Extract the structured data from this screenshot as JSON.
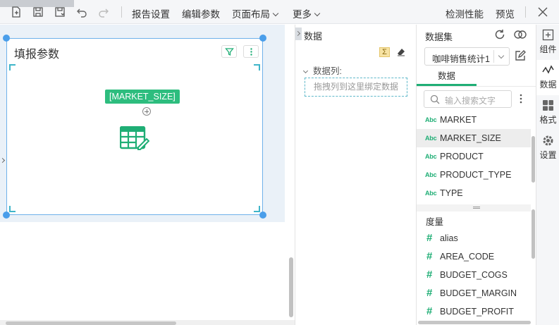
{
  "toolbar": {
    "report_settings": "报告设置",
    "edit_params": "编辑参数",
    "page_layout": "页面布局",
    "more": "更多",
    "check_performance": "检测性能",
    "preview": "预览"
  },
  "widget": {
    "title": "填报参数",
    "tag": "[MARKET_SIZE]"
  },
  "data_panel": {
    "title": "数据",
    "sum_symbol": "Σ",
    "columns_label": "数据列:",
    "drop_placeholder": "拖拽列到这里绑定数据"
  },
  "dataset_panel": {
    "label": "数据集",
    "selected_dataset": "咖啡销售统计1",
    "tab_data": "数据",
    "search_placeholder": "输入搜索文字",
    "dimension_badge": "Abc",
    "measure_badge": "#",
    "dimensions": [
      "MARKET",
      "MARKET_SIZE",
      "PRODUCT",
      "PRODUCT_TYPE",
      "TYPE"
    ],
    "selected_dimension": "MARKET_SIZE",
    "measures_label": "度量",
    "measures": [
      "alias",
      "AREA_CODE",
      "BUDGET_COGS",
      "BUDGET_MARGIN",
      "BUDGET_PROFIT"
    ]
  },
  "rail": {
    "items": [
      "组件",
      "数据",
      "格式",
      "设置"
    ],
    "active": "数据"
  },
  "colors": {
    "accent_green": "#1fae75",
    "selection_blue": "#4a9eea",
    "tag_green": "#2dbd7e"
  }
}
